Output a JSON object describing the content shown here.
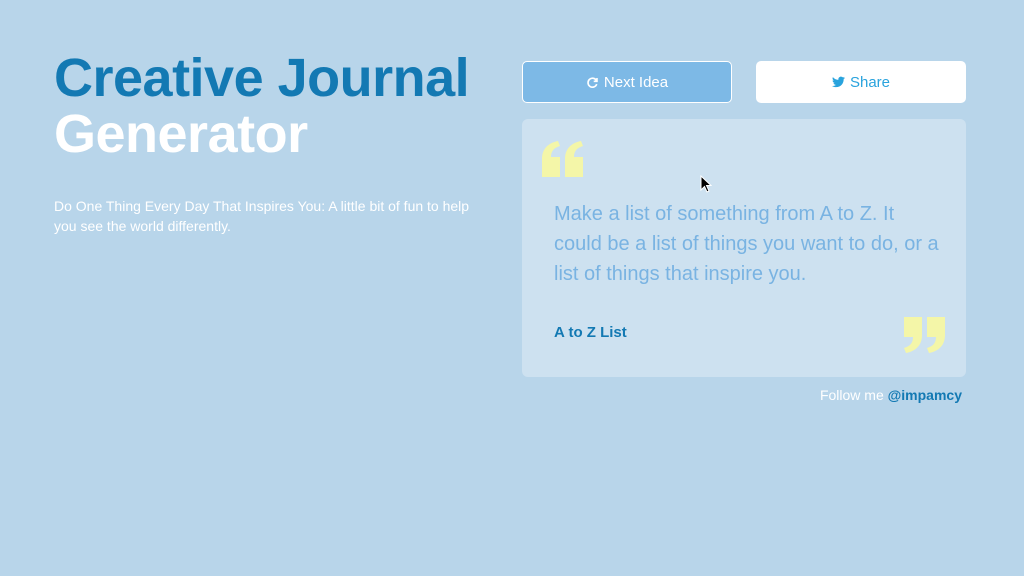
{
  "header": {
    "title_line1": "Creative Journal",
    "title_line2": "Generator",
    "subtitle": "Do One Thing Every Day That Inspires You: A little bit of fun to help you see the world differently."
  },
  "buttons": {
    "next_label": "Next Idea",
    "next_icon": "refresh-icon",
    "share_label": "Share",
    "share_icon": "twitter-icon"
  },
  "quote": {
    "text": "Make a list of something from A to Z. It could be a list of things you want to do, or a list of things that inspire you.",
    "author": "A to Z List"
  },
  "footer": {
    "follow_text": "Follow me",
    "handle": "@impamcy"
  },
  "colors": {
    "background": "#b8d5ea",
    "accent": "#1379b3",
    "quote_mark": "#f4f6a8",
    "card": "#cde1f0",
    "button": "#7db9e6",
    "twitter": "#29a3dd"
  }
}
